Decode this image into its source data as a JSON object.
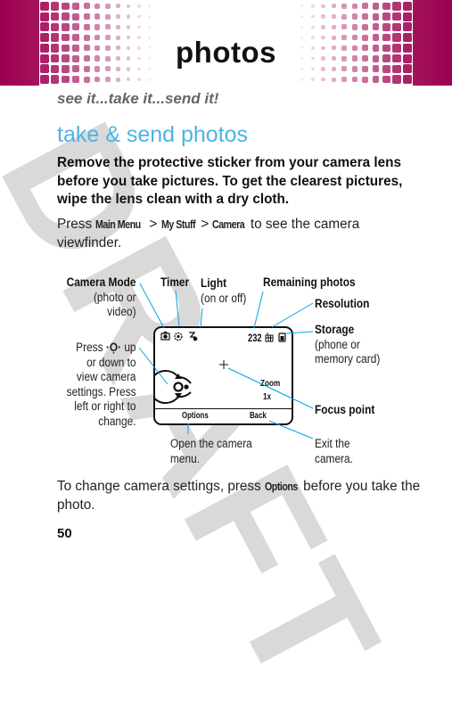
{
  "header": {
    "title": "photos",
    "brand_color": "#9c0050"
  },
  "tagline": "see it...take it...send it!",
  "watermark": "DRAFT",
  "section": {
    "title": "take & send photos",
    "title_color": "#4db3e6",
    "intro": "Remove the protective sticker from your camera lens before you take pictures. To get the clearest pictures, wipe the lens clean with a dry cloth."
  },
  "instructions": {
    "press_prefix": "Press ",
    "path": [
      "Main Menu",
      "My Stuff",
      "Camera"
    ],
    "separator": " > ",
    "suffix": " to see the camera viewfinder."
  },
  "diagram": {
    "labels": {
      "camera_mode_title": "Camera Mode",
      "camera_mode_desc_1": "(photo or",
      "camera_mode_desc_2": "video)",
      "timer": "Timer",
      "light_title": "Light",
      "light_desc": "(on or off)",
      "remaining": "Remaining photos",
      "resolution": "Resolution",
      "storage_title": "Storage",
      "storage_desc_1": "(phone or",
      "storage_desc_2": "memory card)",
      "nav_1_pre": "Press ",
      "nav_1_post": " up",
      "nav_2": "or down to",
      "nav_3": "view camera",
      "nav_4": "settings. Press",
      "nav_5": "left or right to",
      "nav_6": "change.",
      "focus": "Focus point",
      "options_desc_1": "Open the camera",
      "options_desc_2": "menu.",
      "back_desc_1": "Exit the",
      "back_desc_2": "camera."
    },
    "screen": {
      "remaining_count": "232",
      "zoom_label": "Zoom",
      "zoom_value": "1x",
      "left_soft_key": "Options",
      "right_soft_key": "Back"
    },
    "callout_color": "#00a6e0"
  },
  "outro": {
    "prefix": "To change camera settings, press ",
    "keyword": "Options",
    "suffix": " before you take the photo."
  },
  "page_number": "50"
}
